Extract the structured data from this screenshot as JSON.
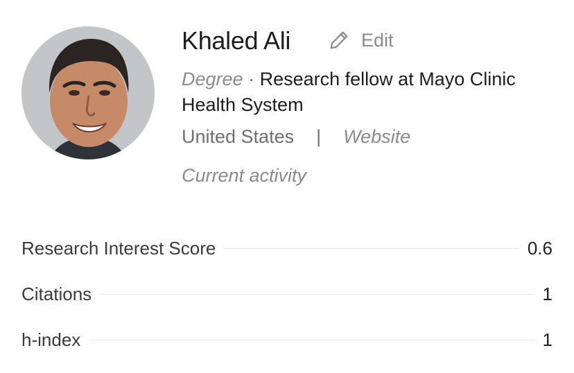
{
  "profile": {
    "name": "Khaled Ali",
    "edit_label": "Edit",
    "degree": "Degree",
    "position_sep": "·",
    "position": "Research fellow at Mayo Clinic Health System",
    "location": "United States",
    "location_sep": "|",
    "website": "Website",
    "current_activity": "Current activity",
    "avatar_icon": "profile-photo"
  },
  "stats": [
    {
      "label": "Research Interest Score",
      "value": "0.6"
    },
    {
      "label": "Citations",
      "value": "1"
    },
    {
      "label": "h-index",
      "value": "1"
    }
  ],
  "colors": {
    "text_primary": "#1d1d1d",
    "text_muted": "#8a8a8a",
    "rule": "#e6e6e6"
  }
}
